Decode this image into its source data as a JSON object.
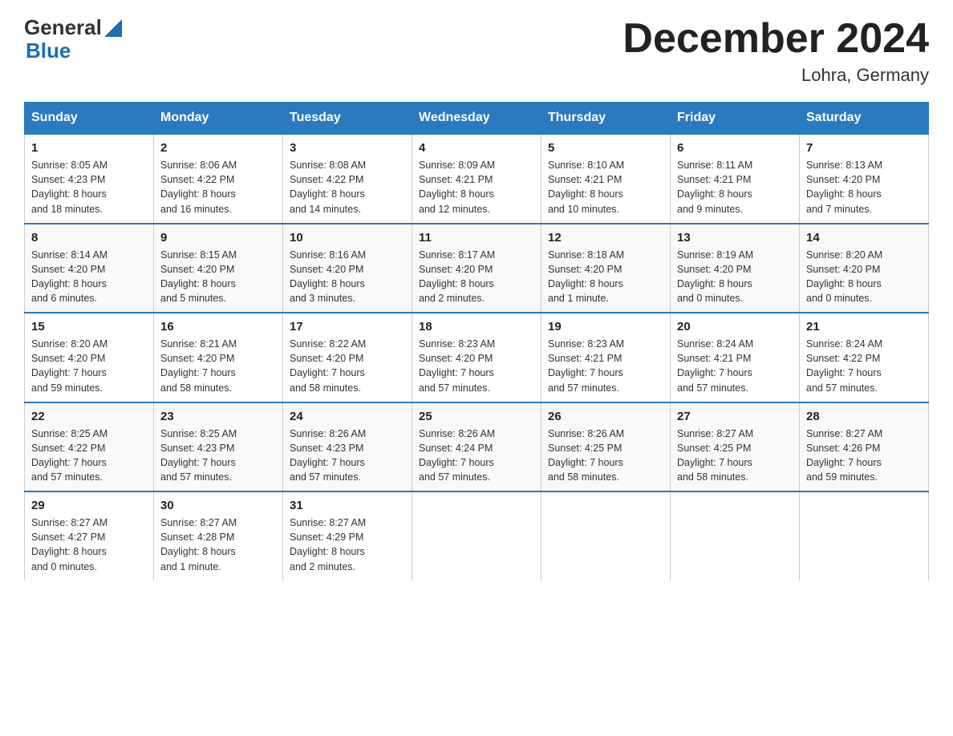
{
  "header": {
    "logo_general": "General",
    "logo_blue": "Blue",
    "title": "December 2024",
    "location": "Lohra, Germany"
  },
  "days_of_week": [
    "Sunday",
    "Monday",
    "Tuesday",
    "Wednesday",
    "Thursday",
    "Friday",
    "Saturday"
  ],
  "weeks": [
    [
      {
        "day": "1",
        "sunrise": "8:05 AM",
        "sunset": "4:23 PM",
        "daylight": "8 hours and 18 minutes."
      },
      {
        "day": "2",
        "sunrise": "8:06 AM",
        "sunset": "4:22 PM",
        "daylight": "8 hours and 16 minutes."
      },
      {
        "day": "3",
        "sunrise": "8:08 AM",
        "sunset": "4:22 PM",
        "daylight": "8 hours and 14 minutes."
      },
      {
        "day": "4",
        "sunrise": "8:09 AM",
        "sunset": "4:21 PM",
        "daylight": "8 hours and 12 minutes."
      },
      {
        "day": "5",
        "sunrise": "8:10 AM",
        "sunset": "4:21 PM",
        "daylight": "8 hours and 10 minutes."
      },
      {
        "day": "6",
        "sunrise": "8:11 AM",
        "sunset": "4:21 PM",
        "daylight": "8 hours and 9 minutes."
      },
      {
        "day": "7",
        "sunrise": "8:13 AM",
        "sunset": "4:20 PM",
        "daylight": "8 hours and 7 minutes."
      }
    ],
    [
      {
        "day": "8",
        "sunrise": "8:14 AM",
        "sunset": "4:20 PM",
        "daylight": "8 hours and 6 minutes."
      },
      {
        "day": "9",
        "sunrise": "8:15 AM",
        "sunset": "4:20 PM",
        "daylight": "8 hours and 5 minutes."
      },
      {
        "day": "10",
        "sunrise": "8:16 AM",
        "sunset": "4:20 PM",
        "daylight": "8 hours and 3 minutes."
      },
      {
        "day": "11",
        "sunrise": "8:17 AM",
        "sunset": "4:20 PM",
        "daylight": "8 hours and 2 minutes."
      },
      {
        "day": "12",
        "sunrise": "8:18 AM",
        "sunset": "4:20 PM",
        "daylight": "8 hours and 1 minute."
      },
      {
        "day": "13",
        "sunrise": "8:19 AM",
        "sunset": "4:20 PM",
        "daylight": "8 hours and 0 minutes."
      },
      {
        "day": "14",
        "sunrise": "8:20 AM",
        "sunset": "4:20 PM",
        "daylight": "8 hours and 0 minutes."
      }
    ],
    [
      {
        "day": "15",
        "sunrise": "8:20 AM",
        "sunset": "4:20 PM",
        "daylight": "7 hours and 59 minutes."
      },
      {
        "day": "16",
        "sunrise": "8:21 AM",
        "sunset": "4:20 PM",
        "daylight": "7 hours and 58 minutes."
      },
      {
        "day": "17",
        "sunrise": "8:22 AM",
        "sunset": "4:20 PM",
        "daylight": "7 hours and 58 minutes."
      },
      {
        "day": "18",
        "sunrise": "8:23 AM",
        "sunset": "4:20 PM",
        "daylight": "7 hours and 57 minutes."
      },
      {
        "day": "19",
        "sunrise": "8:23 AM",
        "sunset": "4:21 PM",
        "daylight": "7 hours and 57 minutes."
      },
      {
        "day": "20",
        "sunrise": "8:24 AM",
        "sunset": "4:21 PM",
        "daylight": "7 hours and 57 minutes."
      },
      {
        "day": "21",
        "sunrise": "8:24 AM",
        "sunset": "4:22 PM",
        "daylight": "7 hours and 57 minutes."
      }
    ],
    [
      {
        "day": "22",
        "sunrise": "8:25 AM",
        "sunset": "4:22 PM",
        "daylight": "7 hours and 57 minutes."
      },
      {
        "day": "23",
        "sunrise": "8:25 AM",
        "sunset": "4:23 PM",
        "daylight": "7 hours and 57 minutes."
      },
      {
        "day": "24",
        "sunrise": "8:26 AM",
        "sunset": "4:23 PM",
        "daylight": "7 hours and 57 minutes."
      },
      {
        "day": "25",
        "sunrise": "8:26 AM",
        "sunset": "4:24 PM",
        "daylight": "7 hours and 57 minutes."
      },
      {
        "day": "26",
        "sunrise": "8:26 AM",
        "sunset": "4:25 PM",
        "daylight": "7 hours and 58 minutes."
      },
      {
        "day": "27",
        "sunrise": "8:27 AM",
        "sunset": "4:25 PM",
        "daylight": "7 hours and 58 minutes."
      },
      {
        "day": "28",
        "sunrise": "8:27 AM",
        "sunset": "4:26 PM",
        "daylight": "7 hours and 59 minutes."
      }
    ],
    [
      {
        "day": "29",
        "sunrise": "8:27 AM",
        "sunset": "4:27 PM",
        "daylight": "8 hours and 0 minutes."
      },
      {
        "day": "30",
        "sunrise": "8:27 AM",
        "sunset": "4:28 PM",
        "daylight": "8 hours and 1 minute."
      },
      {
        "day": "31",
        "sunrise": "8:27 AM",
        "sunset": "4:29 PM",
        "daylight": "8 hours and 2 minutes."
      },
      null,
      null,
      null,
      null
    ]
  ],
  "labels": {
    "sunrise": "Sunrise:",
    "sunset": "Sunset:",
    "daylight": "Daylight:"
  }
}
